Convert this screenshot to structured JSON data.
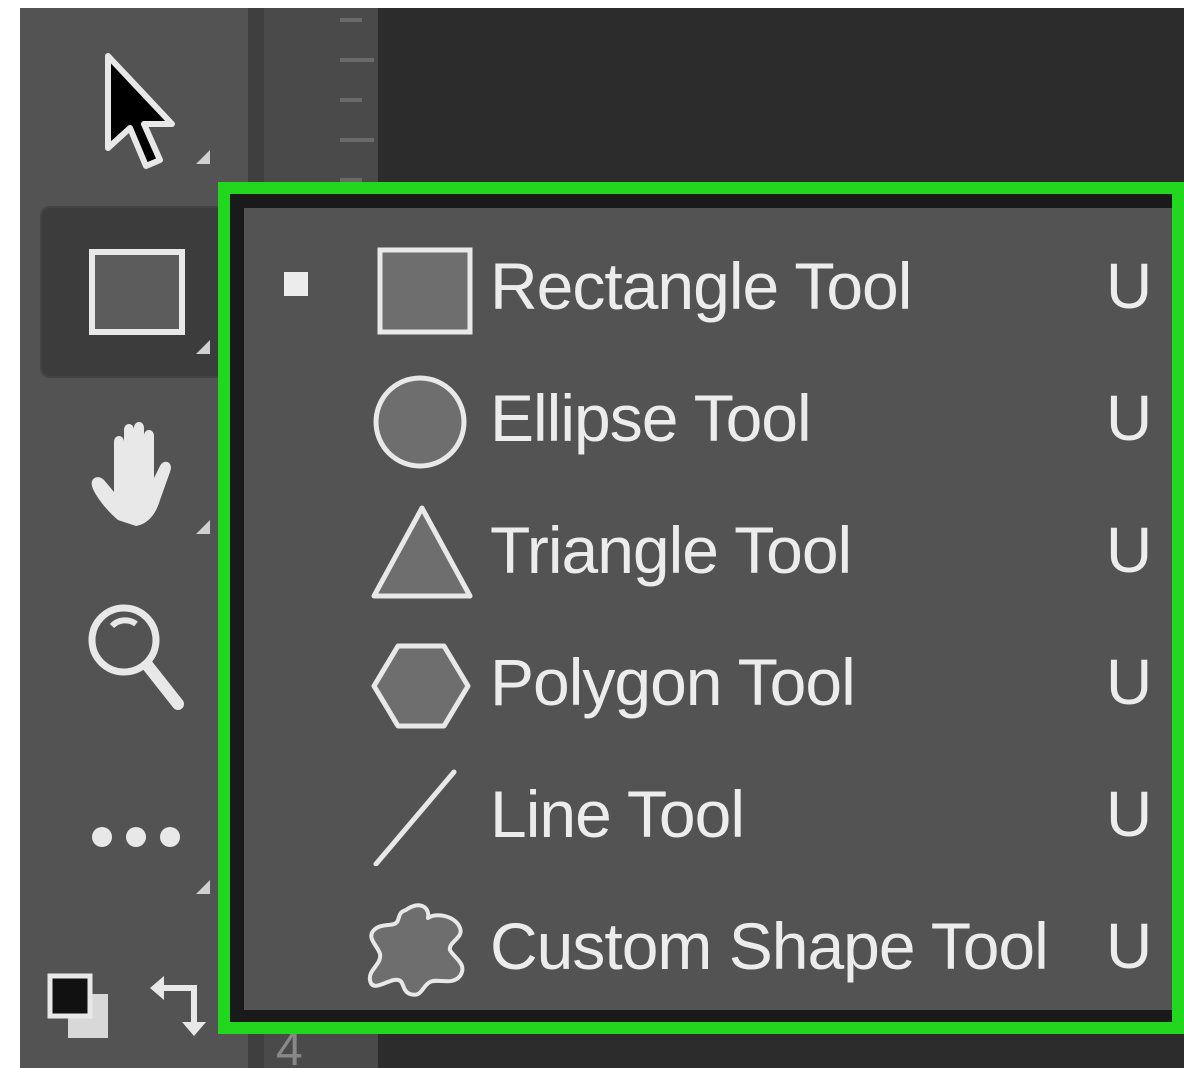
{
  "toolbar": {
    "tools": [
      {
        "name": "Move Tool",
        "icon": "move-arrow-icon"
      },
      {
        "name": "Shape Tool",
        "icon": "rectangle-icon",
        "active": true
      },
      {
        "name": "Hand Tool",
        "icon": "hand-icon"
      },
      {
        "name": "Zoom Tool",
        "icon": "zoom-icon"
      },
      {
        "name": "More Tools",
        "icon": "ellipsis-icon"
      }
    ],
    "colors_icon": "default-colors-icon",
    "swap_icon": "swap-colors-icon"
  },
  "ruler": {
    "visible_number": "4"
  },
  "flyout": {
    "highlight_color": "#22d81f",
    "items": [
      {
        "label": "Rectangle Tool",
        "shortcut": "U",
        "icon": "rectangle-icon",
        "selected": true
      },
      {
        "label": "Ellipse Tool",
        "shortcut": "U",
        "icon": "ellipse-icon",
        "selected": false
      },
      {
        "label": "Triangle Tool",
        "shortcut": "U",
        "icon": "triangle-icon",
        "selected": false
      },
      {
        "label": "Polygon Tool",
        "shortcut": "U",
        "icon": "polygon-icon",
        "selected": false
      },
      {
        "label": "Line Tool",
        "shortcut": "U",
        "icon": "line-icon",
        "selected": false
      },
      {
        "label": "Custom Shape Tool",
        "shortcut": "U",
        "icon": "custom-shape-icon",
        "selected": false
      }
    ]
  },
  "colors": {
    "panel": "#535353",
    "canvas": "#2c2c2c",
    "text": "#ececec",
    "border": "#22d81f"
  }
}
